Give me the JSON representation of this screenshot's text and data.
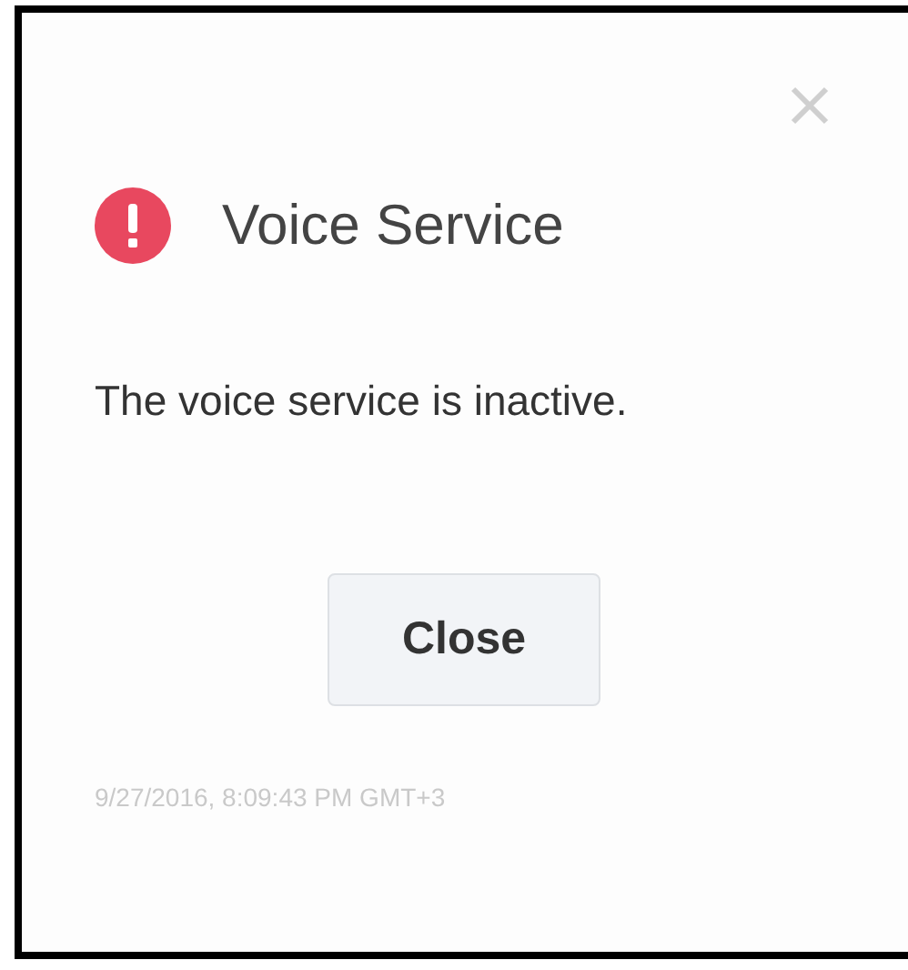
{
  "dialog": {
    "title": "Voice Service",
    "message": "The voice service is inactive.",
    "button": "Close",
    "timestamp": "9/27/2016, 8:09:43 PM GMT+3"
  }
}
